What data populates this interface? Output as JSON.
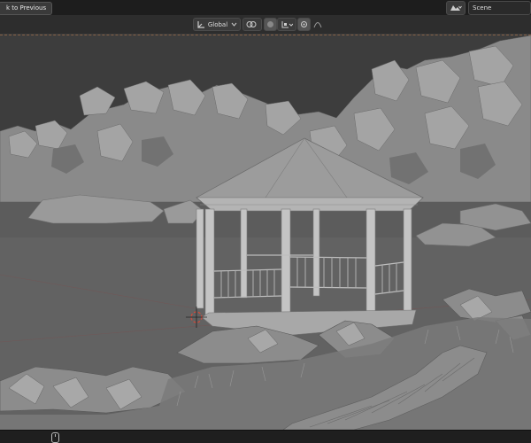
{
  "topbar": {
    "back_label": "k to Previous",
    "scene_label": "Scene",
    "scene_icon": "scene-icon"
  },
  "header": {
    "orientation_value": "Global",
    "orientation_icon": "transform-orientation-icon",
    "pivot_icon": "pivot-icon",
    "snap_icon": "snap-icon",
    "snap_target_icon": "snap-target-icon",
    "proportional_icon": "proportional-edit-icon",
    "falloff_icon": "falloff-icon"
  },
  "statusbar": {
    "mouse_icon": "mouse-icon"
  },
  "colors": {
    "topbar": "#1d1d1d",
    "header": "#2d2d2d",
    "viewport": "#3d3d3d",
    "ground": "#626262",
    "cursor": "#d24a3a"
  }
}
